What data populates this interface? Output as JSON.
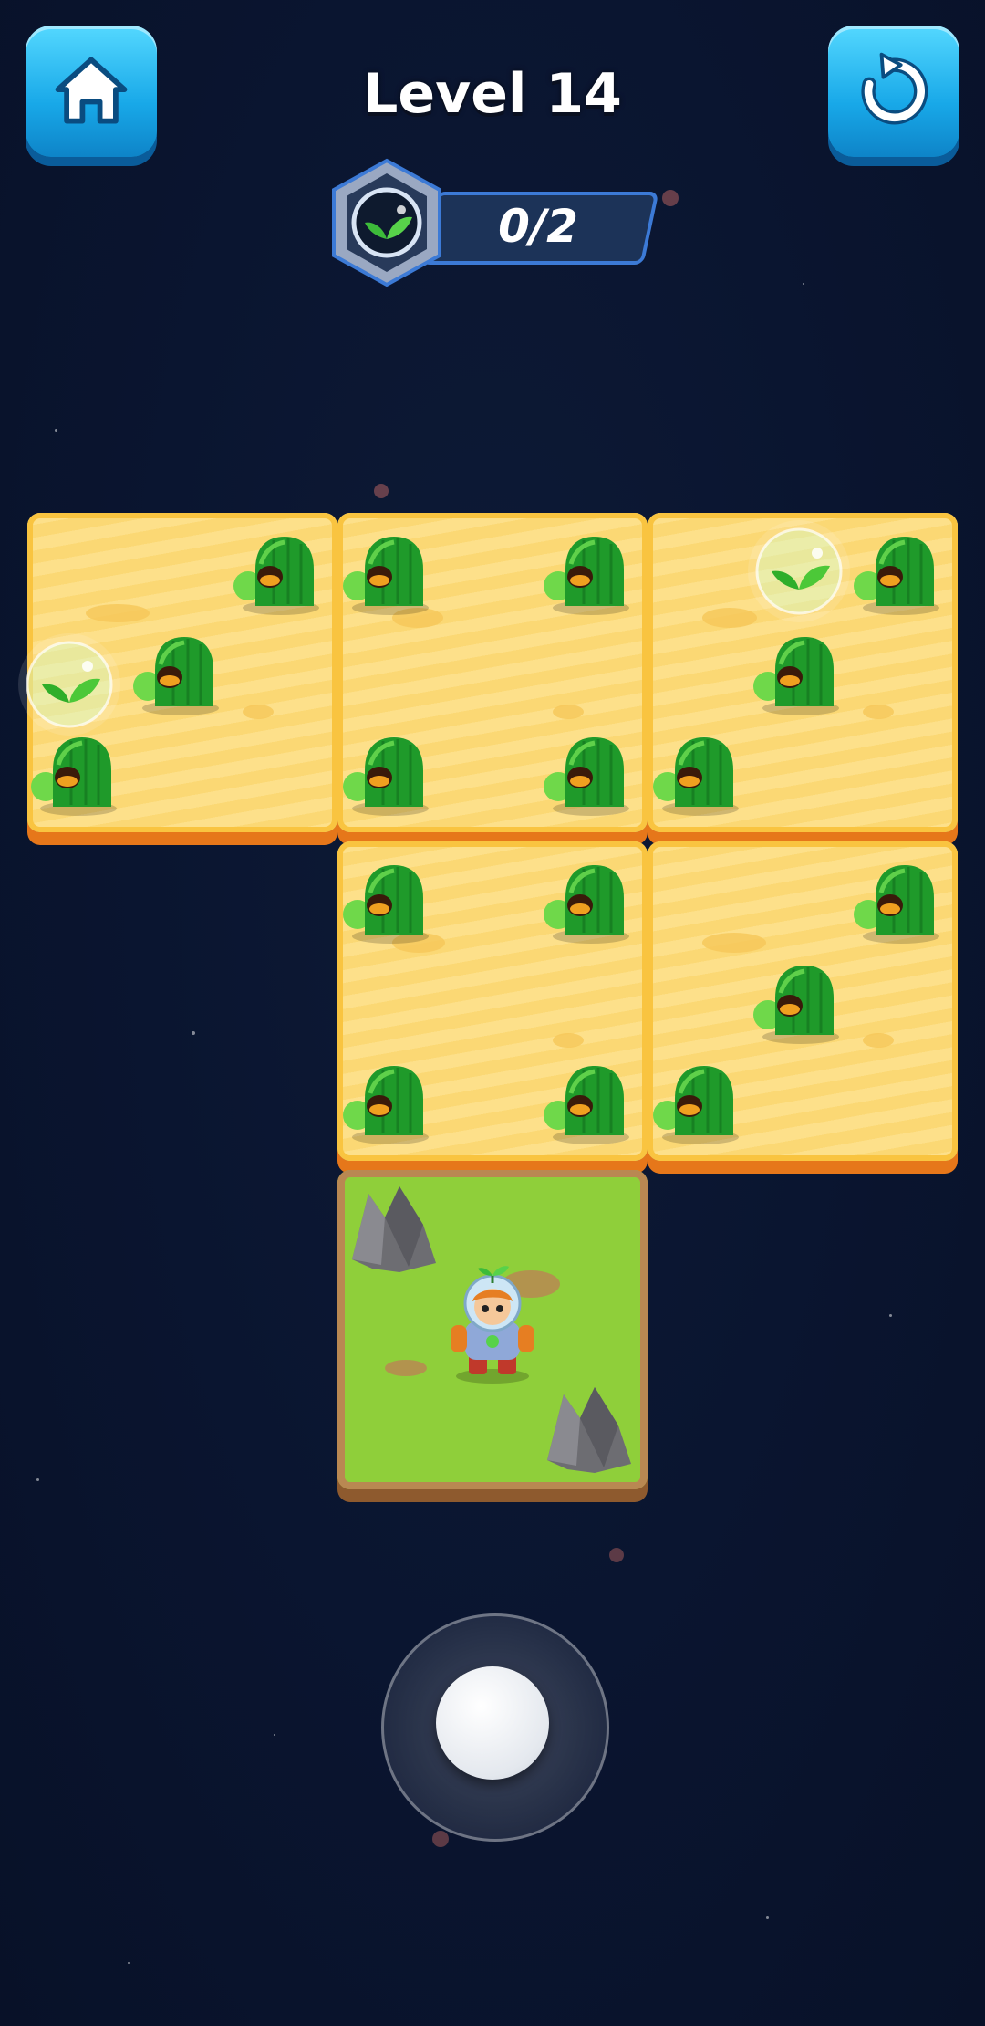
{
  "hud": {
    "level_label": "Level 14",
    "collected_count": "0/2",
    "home_icon": "home-icon",
    "restart_icon": "restart-icon",
    "collect_icon": "seedling-icon"
  },
  "colors": {
    "button_blue": "#18a8e8",
    "sand": "#fde08a",
    "sand_border": "#e6771a",
    "grass": "#8fcf3a",
    "blob_green": "#1f9a2a",
    "space_bg": "#0a1530"
  },
  "board": {
    "tiles": [
      "sand",
      "sand",
      "sand",
      "sand",
      "sand",
      "grass"
    ],
    "seeds_remaining": 2,
    "enemies": "green-blob-alien",
    "player": "astronaut-sprout-hero"
  },
  "controls": {
    "joystick": "virtual-joystick"
  }
}
